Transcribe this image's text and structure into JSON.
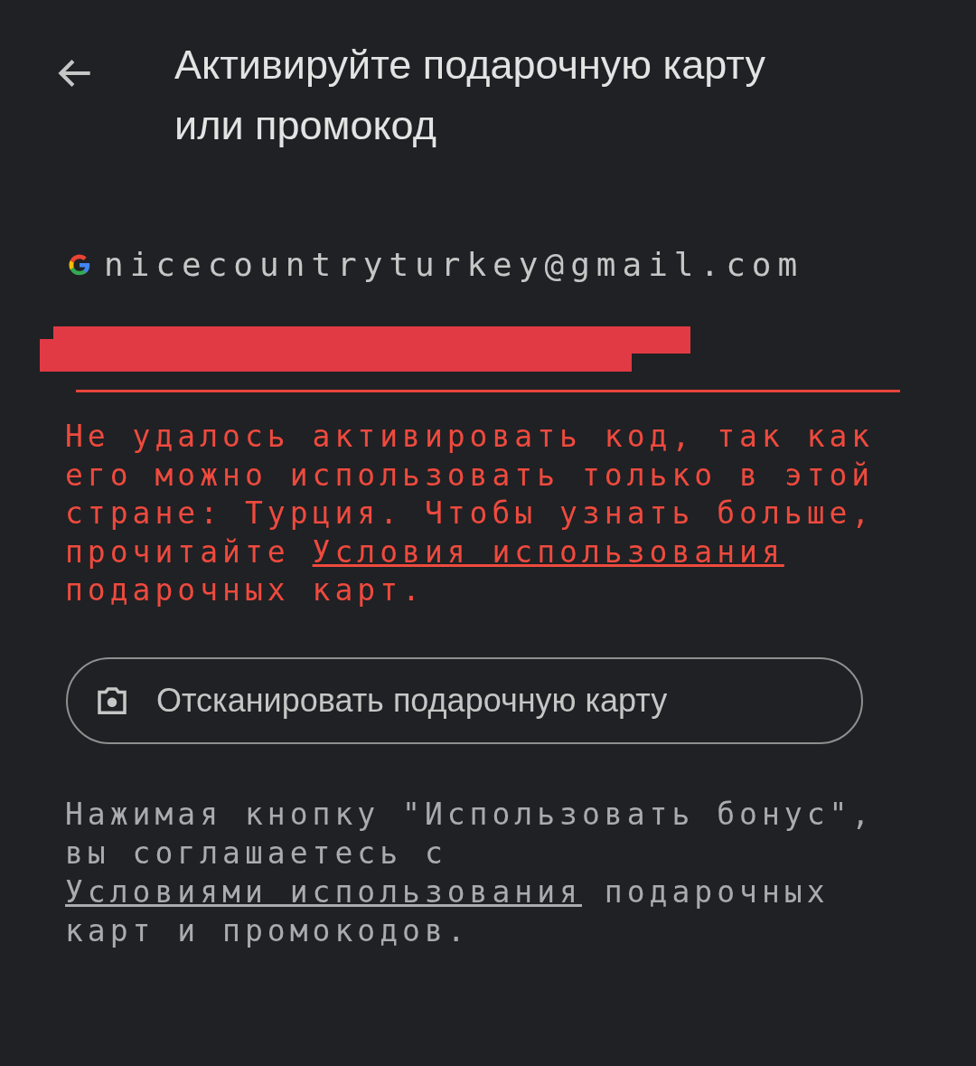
{
  "header": {
    "title": "Активируйте подарочную карту или промокод"
  },
  "account": {
    "email": "nicecountryturkey@gmail.com"
  },
  "code_field": {
    "error": true
  },
  "error_message": {
    "text_before": "Не удалось активировать код, так как его можно использовать только в этой стране: Турция. Чтобы узнать больше, прочитайте ",
    "link": "Условия использования",
    "text_after": " подарочных карт."
  },
  "scan_button": {
    "label": "Отсканировать подарочную карту"
  },
  "terms": {
    "text_before": "Нажимая кнопку \"Использовать бонус\", вы соглашаетесь с ",
    "link": "Условиями использования",
    "text_after": " подарочных карт и промокодов."
  }
}
